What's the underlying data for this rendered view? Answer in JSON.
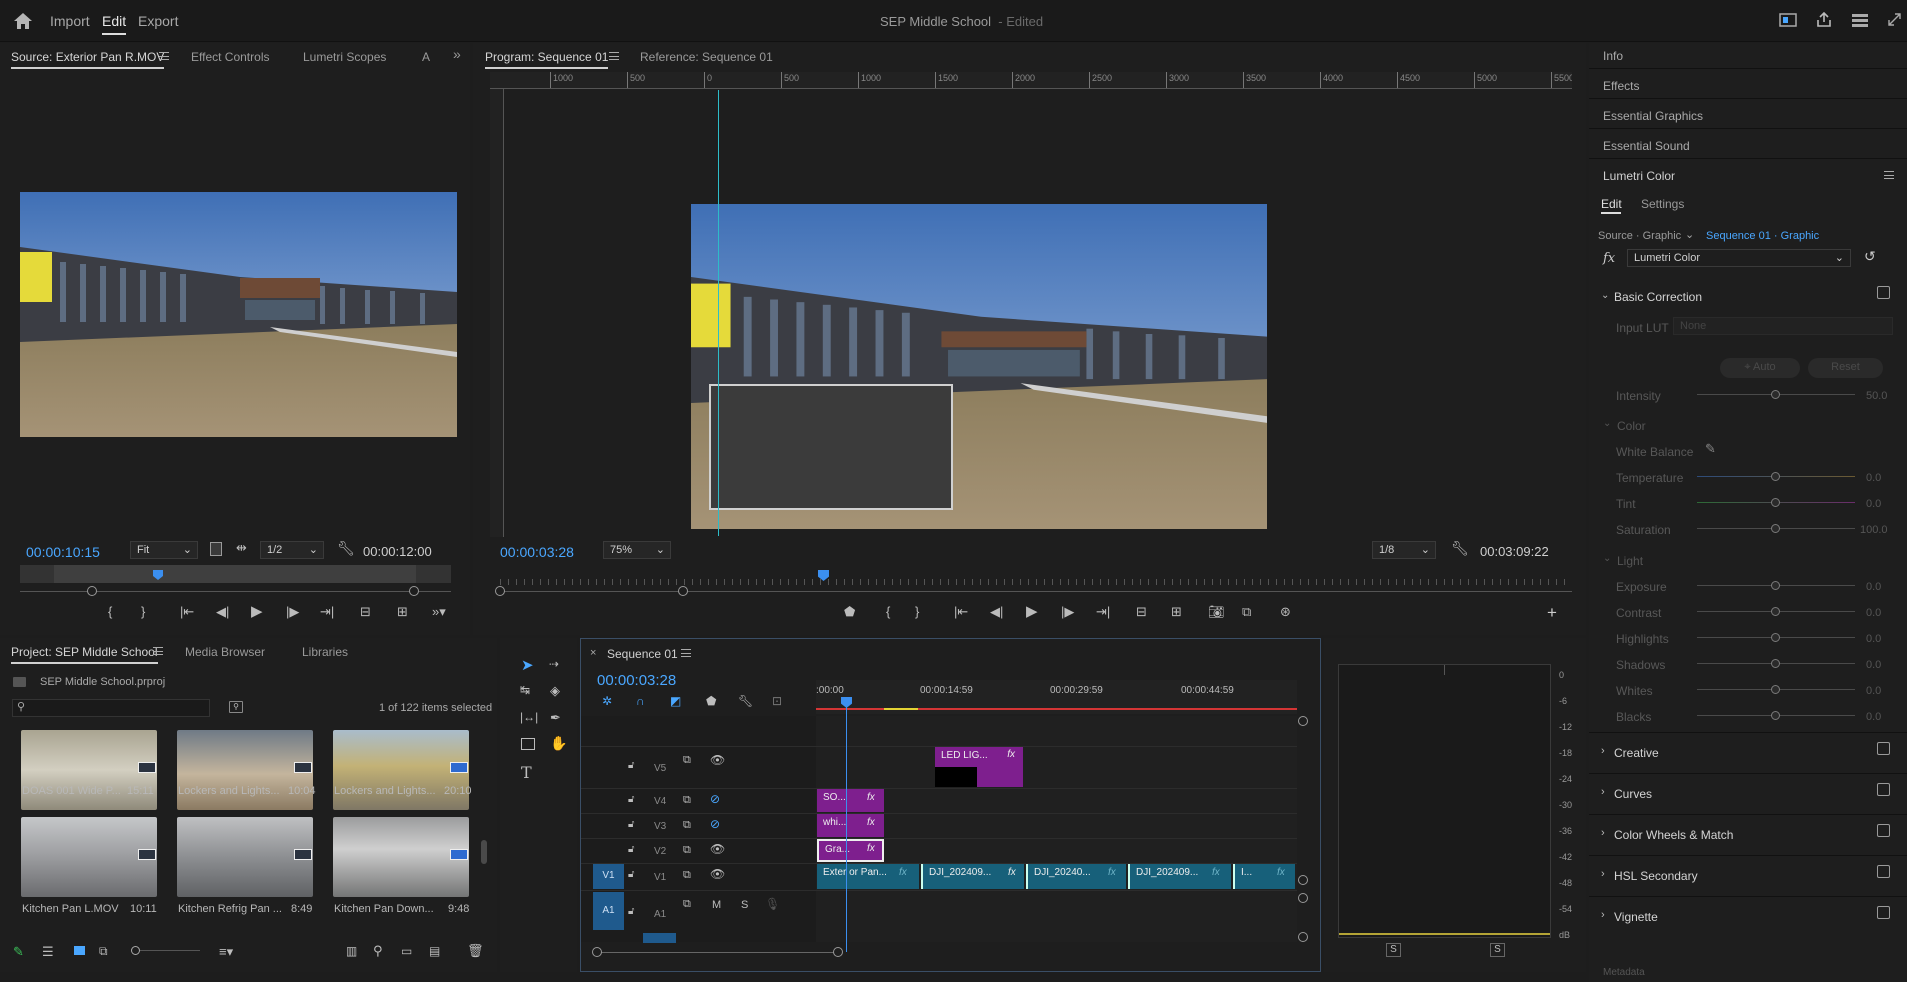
{
  "app": {
    "menu": {
      "import": "Import",
      "edit": "Edit",
      "export": "Export"
    },
    "title": "SEP Middle School",
    "title_status": "- Edited",
    "accent": "#4aa7ff"
  },
  "source_panel": {
    "tabs": [
      "Source: Exterior Pan R.MOV",
      "Effect Controls",
      "Lumetri Scopes",
      "A"
    ],
    "timecode": "00:00:10:15",
    "zoom": "Fit",
    "resolution": "1/2",
    "duration": "00:00:12:00"
  },
  "program_panel": {
    "tabs": [
      "Program: Sequence 01",
      "Reference: Sequence 01"
    ],
    "ruler_ticks": [
      "1000",
      "500",
      "0",
      "500",
      "1000",
      "1500",
      "2000",
      "2500",
      "3000",
      "3500",
      "4000",
      "4500",
      "5000",
      "5500"
    ],
    "timecode": "00:00:03:28",
    "zoom": "75%",
    "resolution": "1/8",
    "duration": "00:03:09:22"
  },
  "right_panels": {
    "items": [
      "Info",
      "Effects",
      "Essential Graphics",
      "Essential Sound",
      "Lumetri Color"
    ]
  },
  "lumetri": {
    "tabs": [
      "Edit",
      "Settings"
    ],
    "source_label": "Source · Graphic",
    "sequence_label": "Sequence 01 · Graphic",
    "fx_label": "fx",
    "effect": "Lumetri Color",
    "basic": "Basic Correction",
    "input_lut_label": "Input LUT",
    "input_lut_value": "None",
    "auto": "Auto",
    "reset": "Reset",
    "intensity": {
      "label": "Intensity",
      "value": "50.0"
    },
    "color_group": "Color",
    "white_balance": "White Balance",
    "color_sliders": [
      {
        "label": "Temperature",
        "value": "0.0"
      },
      {
        "label": "Tint",
        "value": "0.0"
      },
      {
        "label": "Saturation",
        "value": "100.0"
      }
    ],
    "light_group": "Light",
    "light_sliders": [
      {
        "label": "Exposure",
        "value": "0.0"
      },
      {
        "label": "Contrast",
        "value": "0.0"
      },
      {
        "label": "Highlights",
        "value": "0.0"
      },
      {
        "label": "Shadows",
        "value": "0.0"
      },
      {
        "label": "Whites",
        "value": "0.0"
      },
      {
        "label": "Blacks",
        "value": "0.0"
      }
    ],
    "sections": [
      "Creative",
      "Curves",
      "Color Wheels & Match",
      "HSL Secondary",
      "Vignette"
    ],
    "metadata": "Metadata"
  },
  "project_panel": {
    "tabs": [
      "Project: SEP Middle School",
      "Media Browser",
      "Libraries"
    ],
    "file": "SEP Middle School.prproj",
    "selection": "1 of 122 items selected",
    "items": [
      {
        "name": "DOAS 001 Wide P...",
        "duration": "15:11"
      },
      {
        "name": "Lockers and Lights...",
        "duration": "10:04"
      },
      {
        "name": "Lockers and Lights...",
        "duration": "20:10"
      },
      {
        "name": "Kitchen Pan L.MOV",
        "duration": "10:11"
      },
      {
        "name": "Kitchen Refrig Pan ...",
        "duration": "8:49"
      },
      {
        "name": "Kitchen Pan Down...",
        "duration": "9:48"
      }
    ]
  },
  "timeline": {
    "tab": "Sequence 01",
    "timecode": "00:00:03:28",
    "ruler": [
      ":00:00",
      "00:00:14:59",
      "00:00:29:59",
      "00:00:44:59"
    ],
    "tracks": [
      "V5",
      "V4",
      "V3",
      "V2",
      "V1",
      "A1"
    ],
    "track_source_v": "V1",
    "track_source_a": "A1",
    "mute": "M",
    "solo": "S",
    "clips": {
      "v5": "LED LIG...",
      "v4": "SO...",
      "v3": "whi...",
      "v2": "Gra...",
      "v1": [
        "Exter or Pan...",
        "DJI_202409...",
        "DJI_20240...",
        "DJI_202409...",
        "I..."
      ]
    },
    "fx": "fx"
  },
  "meter": {
    "scale": [
      "0",
      "-6",
      "-12",
      "-18",
      "-24",
      "-30",
      "-36",
      "-42",
      "-48",
      "-54",
      "dB"
    ],
    "solo": [
      "S",
      "S"
    ]
  }
}
